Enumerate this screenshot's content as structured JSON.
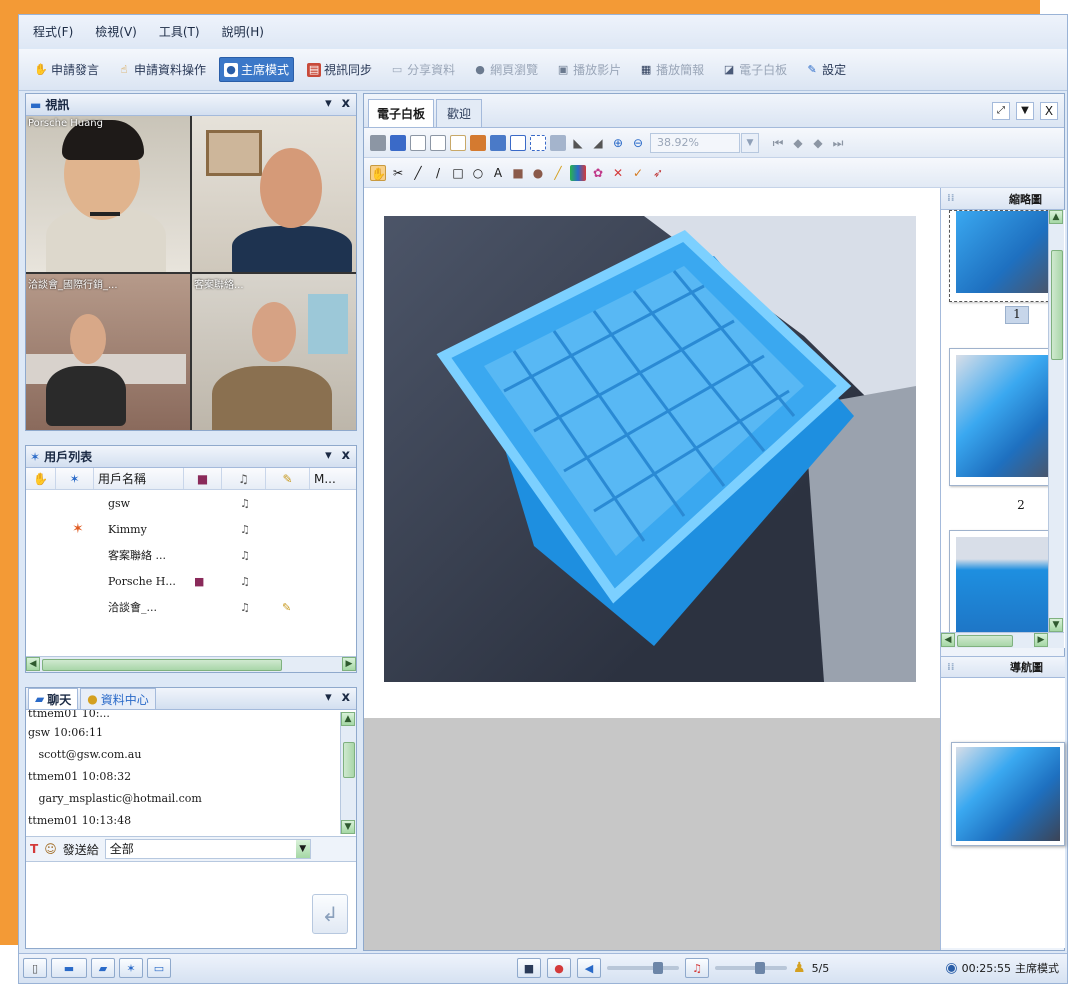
{
  "menu": [
    "程式(F)",
    "檢視(V)",
    "工具(T)",
    "說明(H)"
  ],
  "toolbar": [
    {
      "label": "申請發言",
      "icon": "hand-raise-icon",
      "state": "normal"
    },
    {
      "label": "申請資料操作",
      "icon": "hand-pointer-icon",
      "state": "normal"
    },
    {
      "label": "主席模式",
      "icon": "chair-mode-icon",
      "state": "active"
    },
    {
      "label": "視訊同步",
      "icon": "video-sync-icon",
      "state": "normal"
    },
    {
      "label": "分享資料",
      "icon": "share-data-icon",
      "state": "disabled"
    },
    {
      "label": "網頁瀏覽",
      "icon": "web-browse-icon",
      "state": "disabled"
    },
    {
      "label": "播放影片",
      "icon": "play-video-icon",
      "state": "disabled"
    },
    {
      "label": "播放簡報",
      "icon": "presentation-icon",
      "state": "disabled"
    },
    {
      "label": "電子白板",
      "icon": "whiteboard-icon",
      "state": "disabled"
    },
    {
      "label": "設定",
      "icon": "settings-icon",
      "state": "normal"
    }
  ],
  "video_panel": {
    "title": "視訊",
    "feeds": [
      "Porsche Huang",
      "",
      "洽談會_國際行銷_...",
      "客案聯絡..."
    ]
  },
  "user_list": {
    "title": "用戶列表",
    "columns": [
      "用戶名稱",
      "M..."
    ],
    "rows": [
      {
        "name": "gsw",
        "star": false,
        "camera": false,
        "mic": true,
        "pen": false
      },
      {
        "name": "Kimmy",
        "star": true,
        "camera": false,
        "mic": true,
        "pen": false
      },
      {
        "name": "客案聯絡 ...",
        "star": false,
        "camera": false,
        "mic": true,
        "pen": false
      },
      {
        "name": "Porsche H...",
        "star": false,
        "camera": true,
        "mic": true,
        "pen": false
      },
      {
        "name": "洽談會_...",
        "star": false,
        "camera": false,
        "mic": true,
        "pen": true
      }
    ]
  },
  "chat_panel": {
    "tabs": [
      "聊天",
      "資料中心"
    ],
    "messages": [
      "ttmem01 10:...",
      "gsw 10:06:11",
      "   scott@gsw.com.au",
      "ttmem01 10:08:32",
      "   gary_msplastic@hotmail.com",
      "ttmem01 10:13:48"
    ],
    "send_to_label": "發送給",
    "send_to_value": "全部"
  },
  "whiteboard": {
    "tabs": [
      "電子白板",
      "歡迎"
    ],
    "zoom": "38.92%",
    "thumbnails_title": "縮略圖",
    "navigator_title": "導航圖",
    "thumbnail_numbers": [
      "1",
      "2"
    ]
  },
  "statusbar": {
    "page": "5/5",
    "time": "00:25:55",
    "mode": "主席模式"
  }
}
